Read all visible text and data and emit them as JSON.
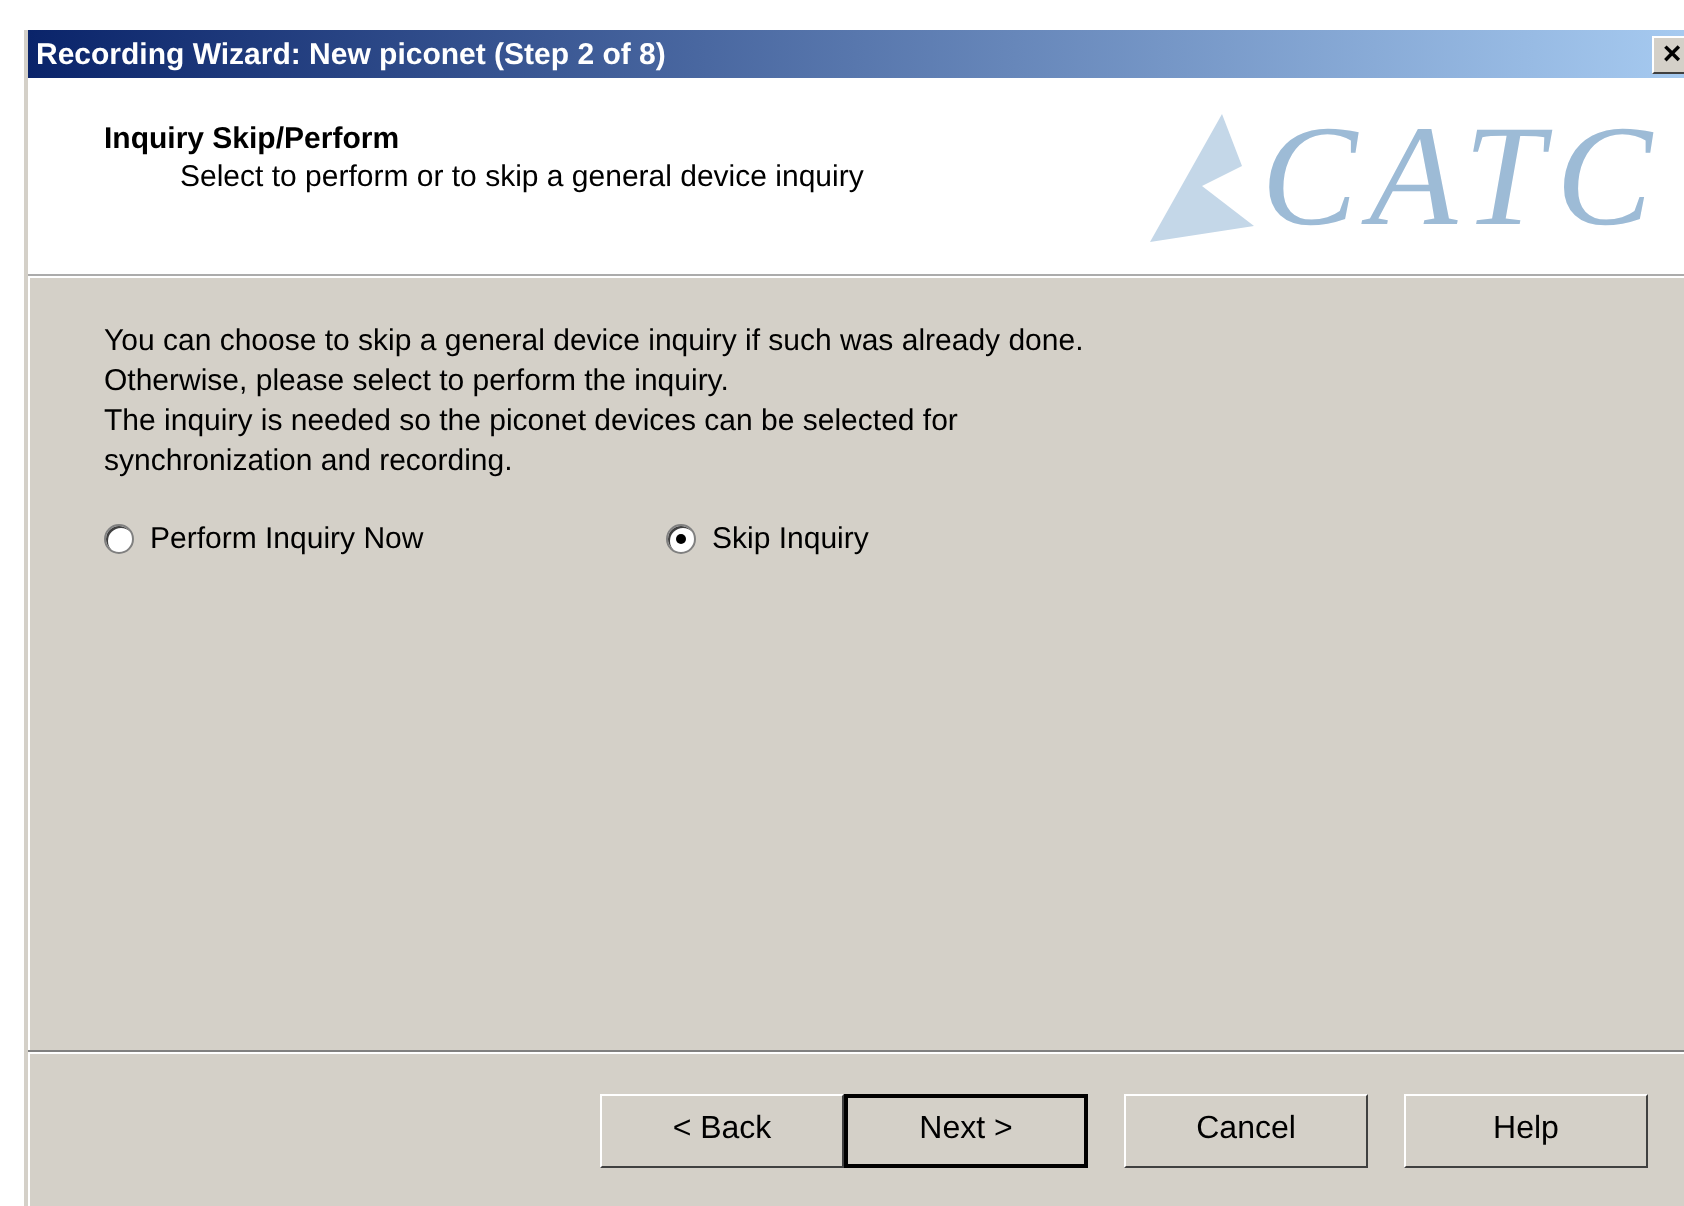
{
  "window": {
    "title": "Recording Wizard: New piconet (Step 2 of 8)",
    "close": "×"
  },
  "header": {
    "title": "Inquiry Skip/Perform",
    "subtitle": "Select to perform or to skip a general device inquiry",
    "logo": "CATC"
  },
  "body": {
    "lines": [
      "You can choose to skip a general device inquiry if such was already done.",
      "Otherwise, please select to perform the inquiry.",
      "The inquiry is needed so the piconet devices can be selected for",
      "synchronization and recording."
    ]
  },
  "options": [
    {
      "label": "Perform Inquiry Now",
      "selected": false
    },
    {
      "label": "Skip Inquiry",
      "selected": true
    }
  ],
  "buttons": [
    {
      "label": "< Back",
      "default": false
    },
    {
      "label": "Next >",
      "default": true
    },
    {
      "label": "Cancel",
      "default": false
    },
    {
      "label": "Help",
      "default": false
    }
  ]
}
